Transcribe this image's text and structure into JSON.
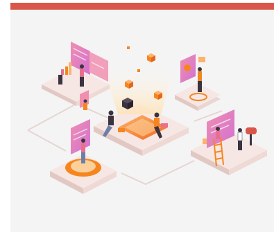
{
  "colors": {
    "accent_bar": "#d9574a",
    "panel_bg": "#f4f4f4",
    "platform_top": "#f6e7e4",
    "platform_side": "#ead6d2",
    "orange": "#f5861f",
    "orange_light": "#fcb36b",
    "pink": "#ea6f8f",
    "violet": "#d78ad6",
    "dark": "#3a3340"
  },
  "illustration": {
    "icons": [
      "cube-icon",
      "screen-icon",
      "chart-icon",
      "ladder-icon",
      "mailbox-icon"
    ]
  }
}
